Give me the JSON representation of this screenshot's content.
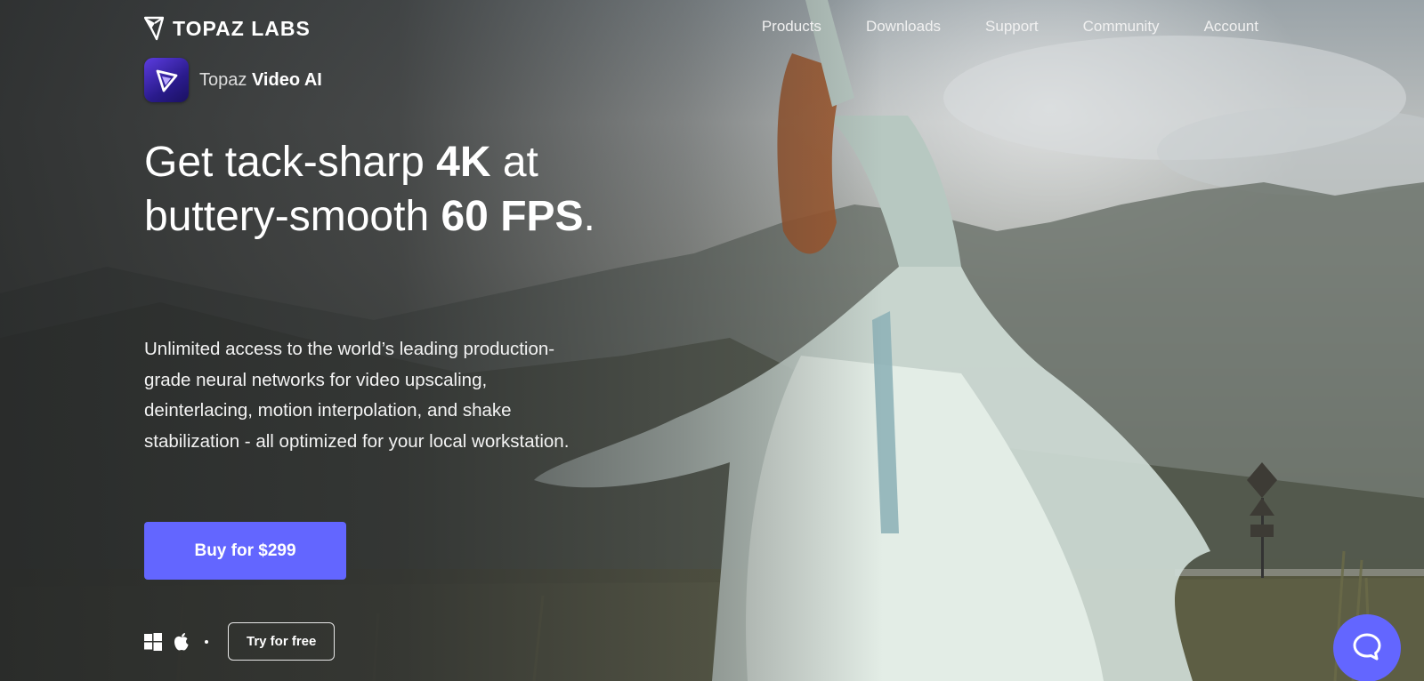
{
  "brand": {
    "name": "TOPAZ LABS",
    "logo_icon": "topaz-gem-icon"
  },
  "nav": {
    "items": [
      "Products",
      "Downloads",
      "Support",
      "Community",
      "Account"
    ]
  },
  "product": {
    "icon": "play-triangle-icon",
    "prefix": "Topaz",
    "name": "Video AI"
  },
  "headline": {
    "part1": "Get tack-sharp ",
    "bold1": "4K",
    "part2": " at buttery-smooth ",
    "bold2": "60 FPS",
    "part3": "."
  },
  "description": "Unlimited access to the world’s leading production-grade neural networks for video upscaling, deinterlacing, motion interpolation, and shake stabilization - all optimized for your local workstation.",
  "cta": {
    "buy_label": "Buy for $299",
    "try_label": "Try for free",
    "platform_icons": [
      "windows-icon",
      "apple-icon"
    ]
  },
  "chat": {
    "icon": "chat-bubble-icon"
  },
  "colors": {
    "accent": "#6366ff",
    "text": "#ffffff"
  }
}
